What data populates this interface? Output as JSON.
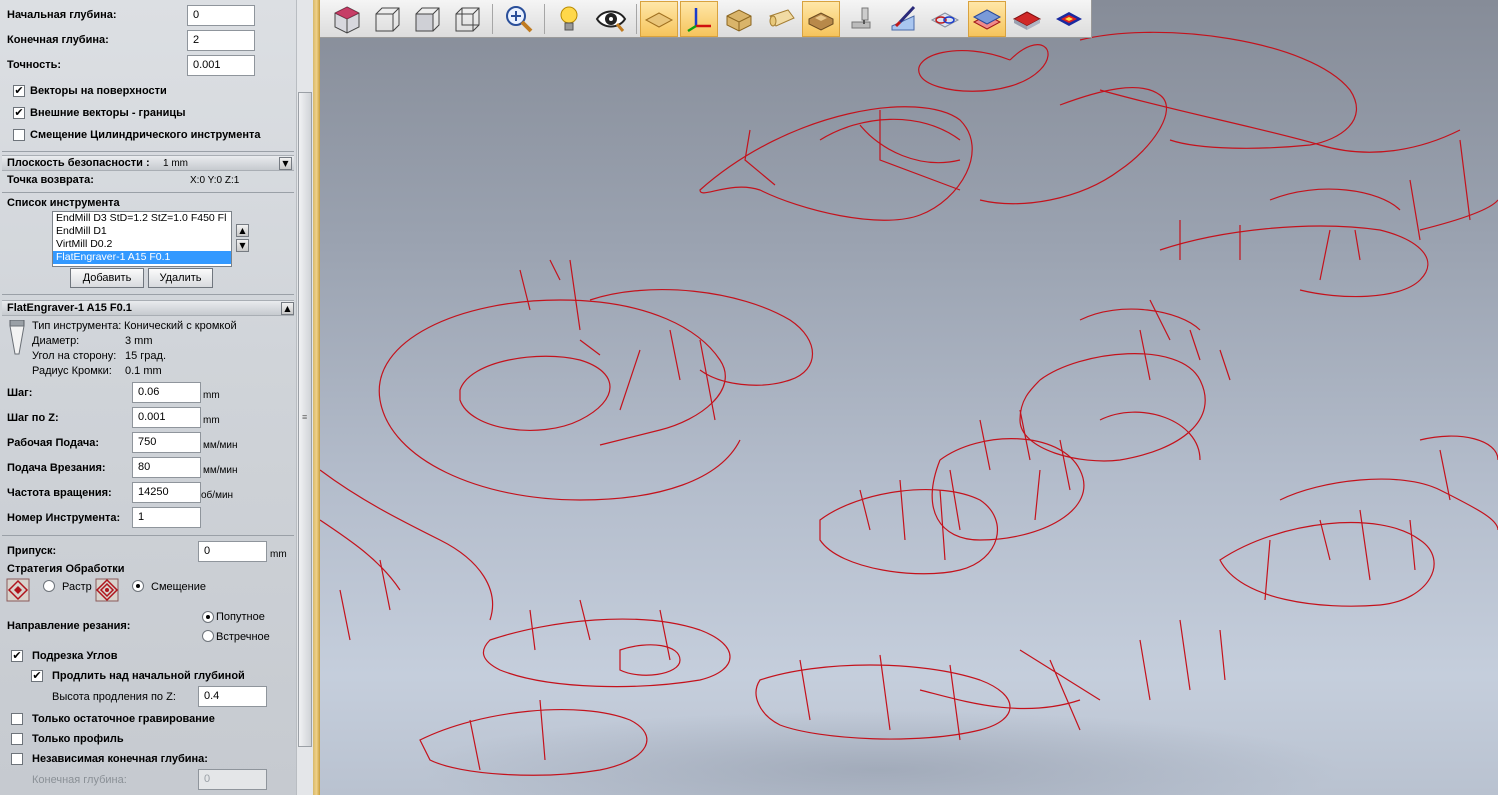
{
  "params": {
    "start_depth": {
      "label": "Начальная глубина:",
      "value": "0"
    },
    "end_depth": {
      "label": "Конечная глубина:",
      "value": "2"
    },
    "tolerance": {
      "label": "Точность:",
      "value": "0.001"
    }
  },
  "checkboxes_top": [
    {
      "label": "Векторы на поверхности",
      "checked": true
    },
    {
      "label": "Внешние векторы - границы",
      "checked": true
    },
    {
      "label": "Смещение Цилиндрического инструмента",
      "checked": false
    }
  ],
  "safety_plane": {
    "label": "Плоскость безопасности :",
    "value": "1 mm"
  },
  "return_point": {
    "label": "Точка возврата:",
    "value": "X:0 Y:0 Z:1"
  },
  "tool_list": {
    "title": "Список инструмента",
    "items": [
      {
        "label": "EndMill D3 StD=1.2 StZ=1.0 F450 Fl",
        "selected": false
      },
      {
        "label": "EndMill D1",
        "selected": false
      },
      {
        "label": "VirtMill D0.2",
        "selected": false
      },
      {
        "label": "FlatEngraver-1 A15 F0.1",
        "selected": true
      }
    ],
    "add_label": "Добавить",
    "delete_label": "Удалить",
    "up_arrow": "▲",
    "down_arrow": "▼"
  },
  "tool_section": {
    "title": "FlatEngraver-1 A15 F0.1",
    "collapse_arrow": "▲",
    "type": {
      "label": "Тип инструмента:",
      "value": "Конический с кромкой"
    },
    "diameter": {
      "label": "Диаметр:",
      "value": "3 mm"
    },
    "angle": {
      "label": "Угол на сторону:",
      "value": "15 град."
    },
    "edge_radius": {
      "label": "Радиус Кромки:",
      "value": "0.1 mm"
    }
  },
  "cutting": {
    "step": {
      "label": "Шаг:",
      "value": "0.06",
      "unit": "mm"
    },
    "step_z": {
      "label": "Шаг по Z:",
      "value": "0.001",
      "unit": "mm"
    },
    "feed": {
      "label": "Рабочая Подача:",
      "value": "750",
      "unit": "мм/мин"
    },
    "plunge": {
      "label": "Подача Врезания:",
      "value": "80",
      "unit": "мм/мин"
    },
    "speed": {
      "label": "Частота вращения:",
      "value": "14250",
      "unit": "об/мин"
    },
    "tool_number": {
      "label": "Номер Инструмента:",
      "value": "1"
    }
  },
  "allowance": {
    "label": "Припуск:",
    "value": "0",
    "unit": "mm"
  },
  "strategy": {
    "title": "Стратегия Обработки",
    "raster_label": "Растр",
    "raster_selected": false,
    "offset_label": "Смещение",
    "offset_selected": true
  },
  "direction": {
    "title": "Направление резания:",
    "climb_label": "Попутное",
    "climb_selected": true,
    "conventional_label": "Встречное",
    "conventional_selected": false
  },
  "corner_cleanup": {
    "label": "Подрезка Углов",
    "checked": true
  },
  "extend_above": {
    "label": "Продлить над начальной глубиной",
    "checked": true
  },
  "extend_height": {
    "label": "Высота продления по Z:",
    "value": "0.4"
  },
  "residual_only": {
    "label": "Только остаточное гравирование",
    "checked": false
  },
  "profile_only": {
    "label": "Только профиль",
    "checked": false
  },
  "independent_depth": {
    "label": "Независимая конечная глубина:",
    "checked": false
  },
  "final_depth": {
    "label": "Конечная глубина:",
    "value": "0"
  },
  "collapse_arrow_down": "▼",
  "check_mark": "✔",
  "scroll_grip": "≡",
  "toolbar": [
    {
      "name": "view-iso-icon",
      "active": false
    },
    {
      "name": "view-front-icon",
      "active": false
    },
    {
      "name": "view-side-icon",
      "active": false
    },
    {
      "name": "view-back-icon",
      "active": false
    },
    {
      "name": "zoom-icon",
      "active": false
    },
    {
      "name": "light-icon",
      "active": false
    },
    {
      "name": "visibility-icon",
      "active": false
    },
    {
      "name": "plane-icon",
      "active": true
    },
    {
      "name": "axes-icon",
      "active": true
    },
    {
      "name": "stock-box-icon",
      "active": false
    },
    {
      "name": "cylinder-icon",
      "active": false
    },
    {
      "name": "model-box-icon",
      "active": true
    },
    {
      "name": "machine-icon",
      "active": false
    },
    {
      "name": "paint-icon",
      "active": false
    },
    {
      "name": "vectors-icon",
      "active": false
    },
    {
      "name": "layers-icon",
      "active": true
    },
    {
      "name": "red-layer-icon",
      "active": false
    },
    {
      "name": "heatmap-icon",
      "active": false
    }
  ],
  "colors": {
    "toolpath": "#c4121c",
    "selection": "#3399ff",
    "active_toolbar": "#f6c45c"
  }
}
